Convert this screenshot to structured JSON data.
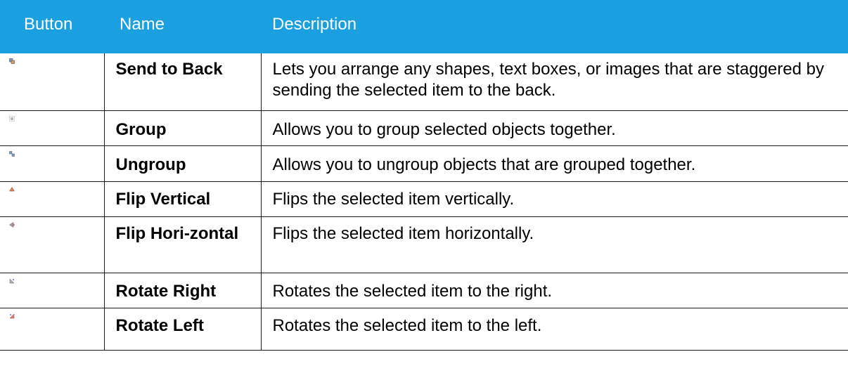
{
  "table": {
    "headers": {
      "button": "Button",
      "name": "Name",
      "description": "Description"
    },
    "rows": [
      {
        "icon": "send-to-back-icon",
        "name": "Send to Back",
        "description": "Lets you arrange any shapes, text boxes, or images that are staggered by sending the selected item to the back."
      },
      {
        "icon": "group-icon",
        "name": "Group",
        "description": "Allows you to group selected objects together."
      },
      {
        "icon": "ungroup-icon",
        "name": "Ungroup",
        "description": "Allows you to ungroup objects that are grouped together."
      },
      {
        "icon": "flip-vertical-icon",
        "name": "Flip Vertical",
        "description": "Flips the selected item vertically."
      },
      {
        "icon": "flip-horizontal-icon",
        "name": "Flip Hori-zontal",
        "description": "Flips the selected item horizontally."
      },
      {
        "icon": "rotate-right-icon",
        "name": "Rotate Right",
        "description": "Rotates the selected item to the right."
      },
      {
        "icon": "rotate-left-icon",
        "name": "Rotate Left",
        "description": "Rotates the selected item to the left."
      }
    ]
  },
  "colors": {
    "header_background": "#1aa0e0",
    "header_text": "#ffffff",
    "border": "#1a1a1a"
  }
}
